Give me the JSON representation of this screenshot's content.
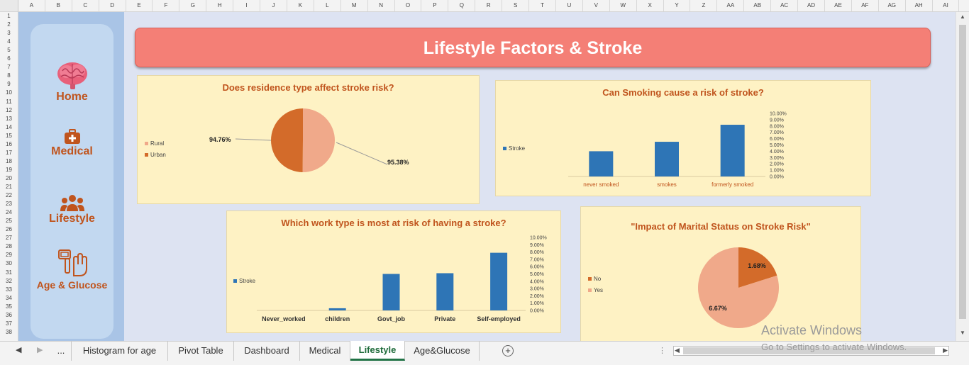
{
  "columns": [
    "A",
    "B",
    "C",
    "D",
    "E",
    "F",
    "G",
    "H",
    "I",
    "J",
    "K",
    "L",
    "M",
    "N",
    "O",
    "P",
    "Q",
    "R",
    "S",
    "T",
    "U",
    "V",
    "W",
    "X",
    "Y",
    "Z",
    "AA",
    "AB",
    "AC",
    "AD",
    "AE",
    "AF",
    "AG",
    "AH",
    "AI"
  ],
  "rows": [
    "1",
    "2",
    "3",
    "4",
    "5",
    "6",
    "7",
    "8",
    "9",
    "10",
    "11",
    "12",
    "13",
    "14",
    "15",
    "16",
    "17",
    "18",
    "19",
    "20",
    "21",
    "22",
    "23",
    "24",
    "25",
    "26",
    "27",
    "28",
    "29",
    "30",
    "31",
    "32",
    "33",
    "34",
    "35",
    "36",
    "37",
    "38"
  ],
  "sidebar": {
    "items": [
      {
        "label": "Home",
        "icon": "brain-icon"
      },
      {
        "label": "Medical",
        "icon": "medical-kit-icon"
      },
      {
        "label": "Lifestyle",
        "icon": "people-icon"
      },
      {
        "label": "Age & Glucose",
        "icon": "glucose-meter-icon"
      }
    ]
  },
  "banner": {
    "title": "Lifestyle Factors & Stroke"
  },
  "colors": {
    "accent": "#c0541d",
    "bar": "#2e75b6",
    "banner": "#f47f76",
    "panel": "#fef2c4",
    "pie_light": "#f0a98a",
    "pie_dark": "#d36b2a"
  },
  "chart_data": [
    {
      "type": "pie",
      "title": "Does residence type affect stroke risk?",
      "labels": [
        "Rural",
        "Urban"
      ],
      "values": [
        95.38,
        94.76
      ],
      "value_labels": [
        "95.38%",
        "94.76%"
      ],
      "legend": "left"
    },
    {
      "type": "bar",
      "title": "Can Smoking cause a risk of stroke?",
      "categories": [
        "never smoked",
        "smokes",
        "formerly smoked"
      ],
      "series": [
        {
          "name": "Stroke",
          "values": [
            4.0,
            5.5,
            8.2
          ]
        }
      ],
      "ylim": [
        0,
        10
      ],
      "yticks": [
        "10.00%",
        "9.00%",
        "8.00%",
        "7.00%",
        "6.00%",
        "5.00%",
        "4.00%",
        "3.00%",
        "2.00%",
        "1.00%",
        "0.00%"
      ],
      "legend": "left"
    },
    {
      "type": "bar",
      "title": "Which work type is most at risk of having a stroke?",
      "categories": [
        "Never_worked",
        "children",
        "Govt_job",
        "Private",
        "Self-employed"
      ],
      "series": [
        {
          "name": "Stroke",
          "values": [
            0.0,
            0.3,
            5.0,
            5.1,
            7.9
          ]
        }
      ],
      "ylim": [
        0,
        10
      ],
      "yticks": [
        "10.00%",
        "9.00%",
        "8.00%",
        "7.00%",
        "6.00%",
        "5.00%",
        "4.00%",
        "3.00%",
        "2.00%",
        "1.00%",
        "0.00%"
      ],
      "legend": "left"
    },
    {
      "type": "pie",
      "title": "\"Impact of Marital Status on Stroke Risk\"",
      "labels": [
        "No",
        "Yes"
      ],
      "values": [
        1.68,
        6.67
      ],
      "value_labels": [
        "1.68%",
        "6.67%"
      ],
      "legend": "left"
    }
  ],
  "tabs": {
    "ellipsis": "...",
    "items": [
      "Histogram for age",
      "Pivot Table",
      "Dashboard",
      "Medical",
      "Lifestyle",
      "Age&Glucose"
    ],
    "active": "Lifestyle"
  },
  "watermark": {
    "line1": "Activate Windows",
    "line2": "Go to Settings to activate Windows."
  }
}
